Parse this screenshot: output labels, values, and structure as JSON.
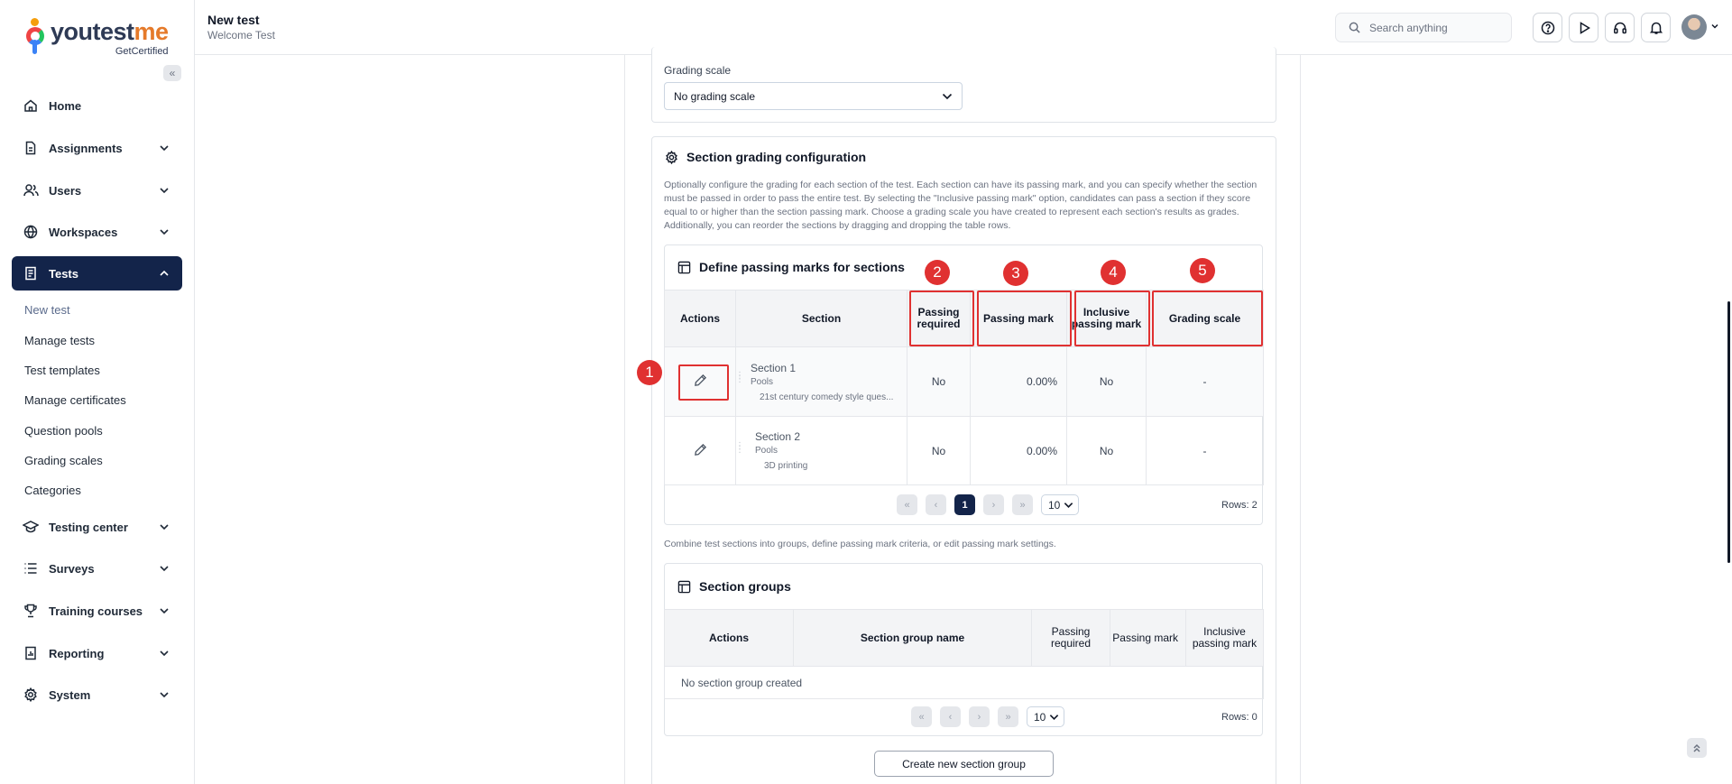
{
  "brand": {
    "name_main": "youtest",
    "name_accent": "me",
    "sub": "GetCertified"
  },
  "sidebar": {
    "collapse_glyph": "«",
    "items": [
      {
        "label": "Home",
        "icon": "home-icon"
      },
      {
        "label": "Assignments",
        "icon": "document-icon"
      },
      {
        "label": "Users",
        "icon": "users-icon"
      },
      {
        "label": "Workspaces",
        "icon": "globe-icon"
      },
      {
        "label": "Tests",
        "icon": "test-icon",
        "active": true
      },
      {
        "label": "Testing center",
        "icon": "graduation-cap-icon"
      },
      {
        "label": "Surveys",
        "icon": "list-icon"
      },
      {
        "label": "Training courses",
        "icon": "trophy-icon"
      },
      {
        "label": "Reporting",
        "icon": "report-icon"
      },
      {
        "label": "System",
        "icon": "gear-icon"
      }
    ],
    "tests_sub": [
      "New test",
      "Manage tests",
      "Test templates",
      "Manage certificates",
      "Question pools",
      "Grading scales",
      "Categories"
    ]
  },
  "header": {
    "title": "New test",
    "subtitle": "Welcome Test",
    "search_placeholder": "Search anything"
  },
  "grading": {
    "label": "Grading scale",
    "value": "No grading scale"
  },
  "section_config": {
    "title": "Section grading configuration",
    "description": "Optionally configure the grading for each section of the test. Each section can have its passing mark, and you can specify whether the section must be passed in order to pass the entire test. By selecting the \"Inclusive passing mark\" option, candidates can pass a section if they score equal to or higher than the section passing mark. Choose a grading scale you have created to represent each section's results as grades. Additionally, you can reorder the sections by dragging and dropping the table rows.",
    "table_title": "Define passing marks for sections",
    "columns": [
      "Actions",
      "Section",
      "Passing required",
      "Passing mark",
      "Inclusive passing mark",
      "Grading scale"
    ],
    "rows": [
      {
        "name": "Section 1",
        "pools_label": "Pools",
        "pool": "21st century comedy style ques...",
        "passing_required": "No",
        "passing_mark": "0.00%",
        "inclusive": "No",
        "grading_scale": "-"
      },
      {
        "name": "Section 2",
        "pools_label": "Pools",
        "pool": "3D printing",
        "passing_required": "No",
        "passing_mark": "0.00%",
        "inclusive": "No",
        "grading_scale": "-"
      }
    ],
    "pager": {
      "page": "1",
      "page_size": "10",
      "rows": "Rows: 2"
    }
  },
  "groups": {
    "hint": "Combine test sections into groups, define passing mark criteria, or edit passing mark settings.",
    "title": "Section groups",
    "columns": [
      "Actions",
      "Section group name",
      "Passing required",
      "Passing mark",
      "Inclusive passing mark"
    ],
    "empty": "No section group created",
    "pager": {
      "page_size": "10",
      "rows": "Rows: 0"
    },
    "create_button": "Create new section group"
  },
  "annotations": [
    "1",
    "2",
    "3",
    "4",
    "5"
  ],
  "colors": {
    "primary": "#13244a",
    "annotation": "#e03131",
    "accent": "#e57a2a"
  }
}
